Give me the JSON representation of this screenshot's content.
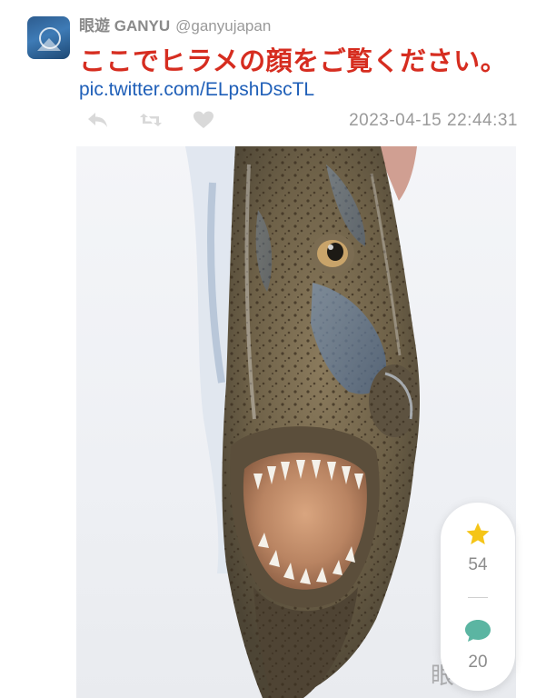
{
  "author": {
    "display_name": "眼遊 GANYU",
    "handle": "@ganyujapan"
  },
  "tweet": {
    "text": "ここでヒラメの顔をご覧ください。",
    "link": "pic.twitter.com/ELpshDscTL",
    "timestamp": "2023-04-15 22:44:31"
  },
  "actions": {
    "reply_icon": "reply-icon",
    "retweet_icon": "retweet-icon",
    "like_icon": "heart-icon"
  },
  "photo": {
    "watermark": "眼遊"
  },
  "stats": {
    "stars": "54",
    "comments": "20"
  },
  "colors": {
    "tweet_text": "#d62d20",
    "link": "#1f5fb8",
    "star": "#f5c518",
    "comment_bubble": "#5bb5a2"
  }
}
